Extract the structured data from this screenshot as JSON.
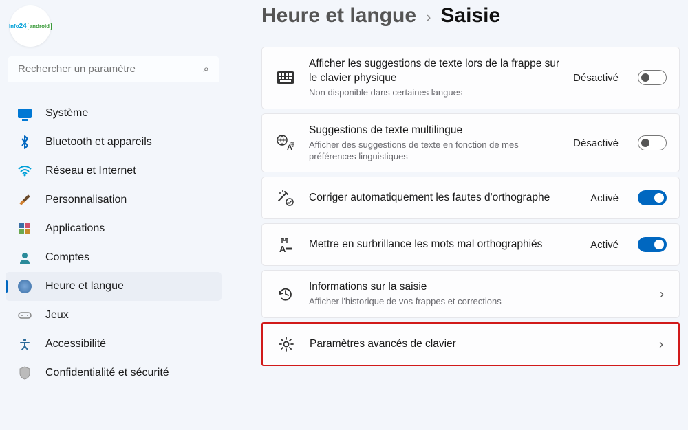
{
  "avatar": {
    "part1": "Info",
    "part2": "android",
    "digit": "24"
  },
  "search": {
    "placeholder": "Rechercher un paramètre"
  },
  "sidebar": {
    "items": [
      {
        "label": "Système"
      },
      {
        "label": "Bluetooth et appareils"
      },
      {
        "label": "Réseau et Internet"
      },
      {
        "label": "Personnalisation"
      },
      {
        "label": "Applications"
      },
      {
        "label": "Comptes"
      },
      {
        "label": "Heure et langue"
      },
      {
        "label": "Jeux"
      },
      {
        "label": "Accessibilité"
      },
      {
        "label": "Confidentialité et sécurité"
      }
    ]
  },
  "breadcrumb": {
    "parent": "Heure et langue",
    "sep": "›",
    "current": "Saisie"
  },
  "cards": [
    {
      "title": "Afficher les suggestions de texte lors de la frappe sur le clavier physique",
      "sub": "Non disponible dans certaines langues",
      "stateLabel": "Désactivé",
      "toggle": "off"
    },
    {
      "title": "Suggestions de texte multilingue",
      "sub": "Afficher des suggestions de texte en fonction de mes préférences linguistiques",
      "stateLabel": "Désactivé",
      "toggle": "off"
    },
    {
      "title": "Corriger automatiquement les fautes d'orthographe",
      "stateLabel": "Activé",
      "toggle": "on"
    },
    {
      "title": "Mettre en surbrillance les mots mal orthographiés",
      "stateLabel": "Activé",
      "toggle": "on"
    },
    {
      "title": "Informations sur la saisie",
      "sub": "Afficher l'historique de vos frappes et corrections",
      "nav": true
    },
    {
      "title": "Paramètres avancés de clavier",
      "nav": true,
      "highlight": true
    }
  ]
}
